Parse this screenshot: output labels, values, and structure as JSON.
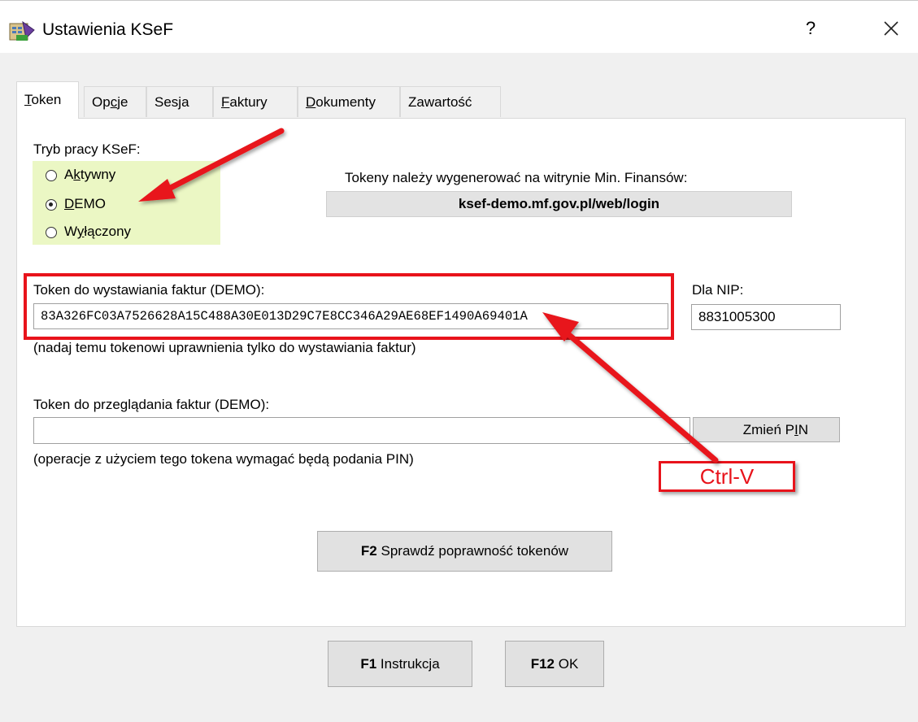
{
  "window": {
    "title": "Ustawienia KSeF",
    "help_glyph": "?",
    "app_icon": "ksef-app-icon",
    "close_icon": "close-icon"
  },
  "tabs": [
    {
      "prefix": "",
      "mnemonic": "T",
      "rest": "oken",
      "active": true
    },
    {
      "prefix": "Op",
      "mnemonic": "c",
      "rest": "je",
      "active": false
    },
    {
      "prefix": "",
      "mnemonic": "",
      "rest": "Sesja",
      "active": false
    },
    {
      "prefix": "",
      "mnemonic": "F",
      "rest": "aktury",
      "active": false
    },
    {
      "prefix": "",
      "mnemonic": "D",
      "rest": "okumenty",
      "active": false
    },
    {
      "prefix": "",
      "mnemonic": "",
      "rest": "Zawartość",
      "active": false
    }
  ],
  "mode": {
    "label": "Tryb pracy KSeF:",
    "options": [
      {
        "prefix": "A",
        "mnemonic": "k",
        "rest": "tywny",
        "selected": false
      },
      {
        "prefix": "",
        "mnemonic": "D",
        "rest": "EMO",
        "selected": true
      },
      {
        "prefix": "W",
        "mnemonic": "y",
        "rest": "łączony",
        "selected": false
      }
    ],
    "highlight_color": "#ebf7c4"
  },
  "info": {
    "text": "Tokeny należy wygenerować na witrynie Min. Finansów:",
    "link": "ksef-demo.mf.gov.pl/web/login"
  },
  "issue_token": {
    "label": "Token do wystawiania faktur (DEMO):",
    "value": "83A326FC03A7526628A15C488A30E013D29C7E8CC346A29AE68EF1490A69401A",
    "hint": "(nadaj temu tokenowi uprawnienia tylko do wystawiania faktur)"
  },
  "nip": {
    "label": "Dla NIP:",
    "value": "8831005300"
  },
  "view_token": {
    "label": "Token do przeglądania faktur (DEMO):",
    "value": "",
    "hint": "(operacje z użyciem tego tokena wymagać będą podania PIN)",
    "pin_button_prefix": "Zmień P",
    "pin_button_mnemonic": "I",
    "pin_button_rest": "N"
  },
  "check_button": {
    "key": "F2",
    "label": "Sprawdź poprawność tokenów"
  },
  "footer": {
    "help_button": {
      "key": "F1",
      "label": "Instrukcja"
    },
    "ok_button": {
      "key": "F12",
      "label": "OK"
    }
  },
  "annotations": {
    "callout": "Ctrl-V",
    "color": "#e8131b"
  }
}
